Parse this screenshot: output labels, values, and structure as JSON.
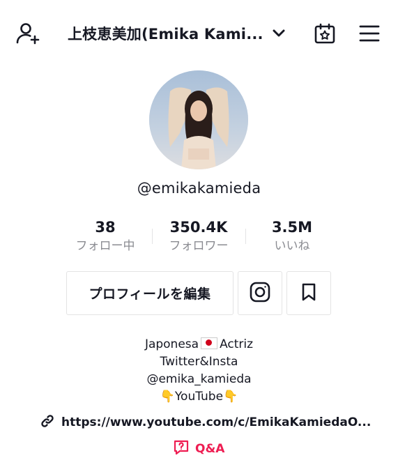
{
  "header": {
    "title": "上枝恵美加(Emika Kami...",
    "icons": {
      "add_user": "add-user-icon",
      "dropdown": "chevron-down-icon",
      "calendar": "calendar-star-icon",
      "menu": "hamburger-menu-icon"
    }
  },
  "profile": {
    "username": "@emikakamieda"
  },
  "stats": [
    {
      "value": "38",
      "label": "フォロー中"
    },
    {
      "value": "350.4K",
      "label": "フォロワー"
    },
    {
      "value": "3.5M",
      "label": "いいね"
    }
  ],
  "actions": {
    "edit_profile_label": "プロフィールを編集",
    "instagram_icon": "instagram-icon",
    "bookmark_icon": "bookmark-icon"
  },
  "bio": {
    "line1_a": "Japonesa",
    "line1_b": "Actriz",
    "line2": "Twitter&Insta",
    "line3": "@emika_kamieda",
    "line4_emoji_left": "👇",
    "line4_text": "YouTube",
    "line4_emoji_right": "👇"
  },
  "link": {
    "icon": "link-icon",
    "text": "https://www.youtube.com/c/EmikaKamiedaO..."
  },
  "qa": {
    "icon": "question-bubble-icon",
    "label": "Q&A",
    "color": "#ee1d52"
  }
}
